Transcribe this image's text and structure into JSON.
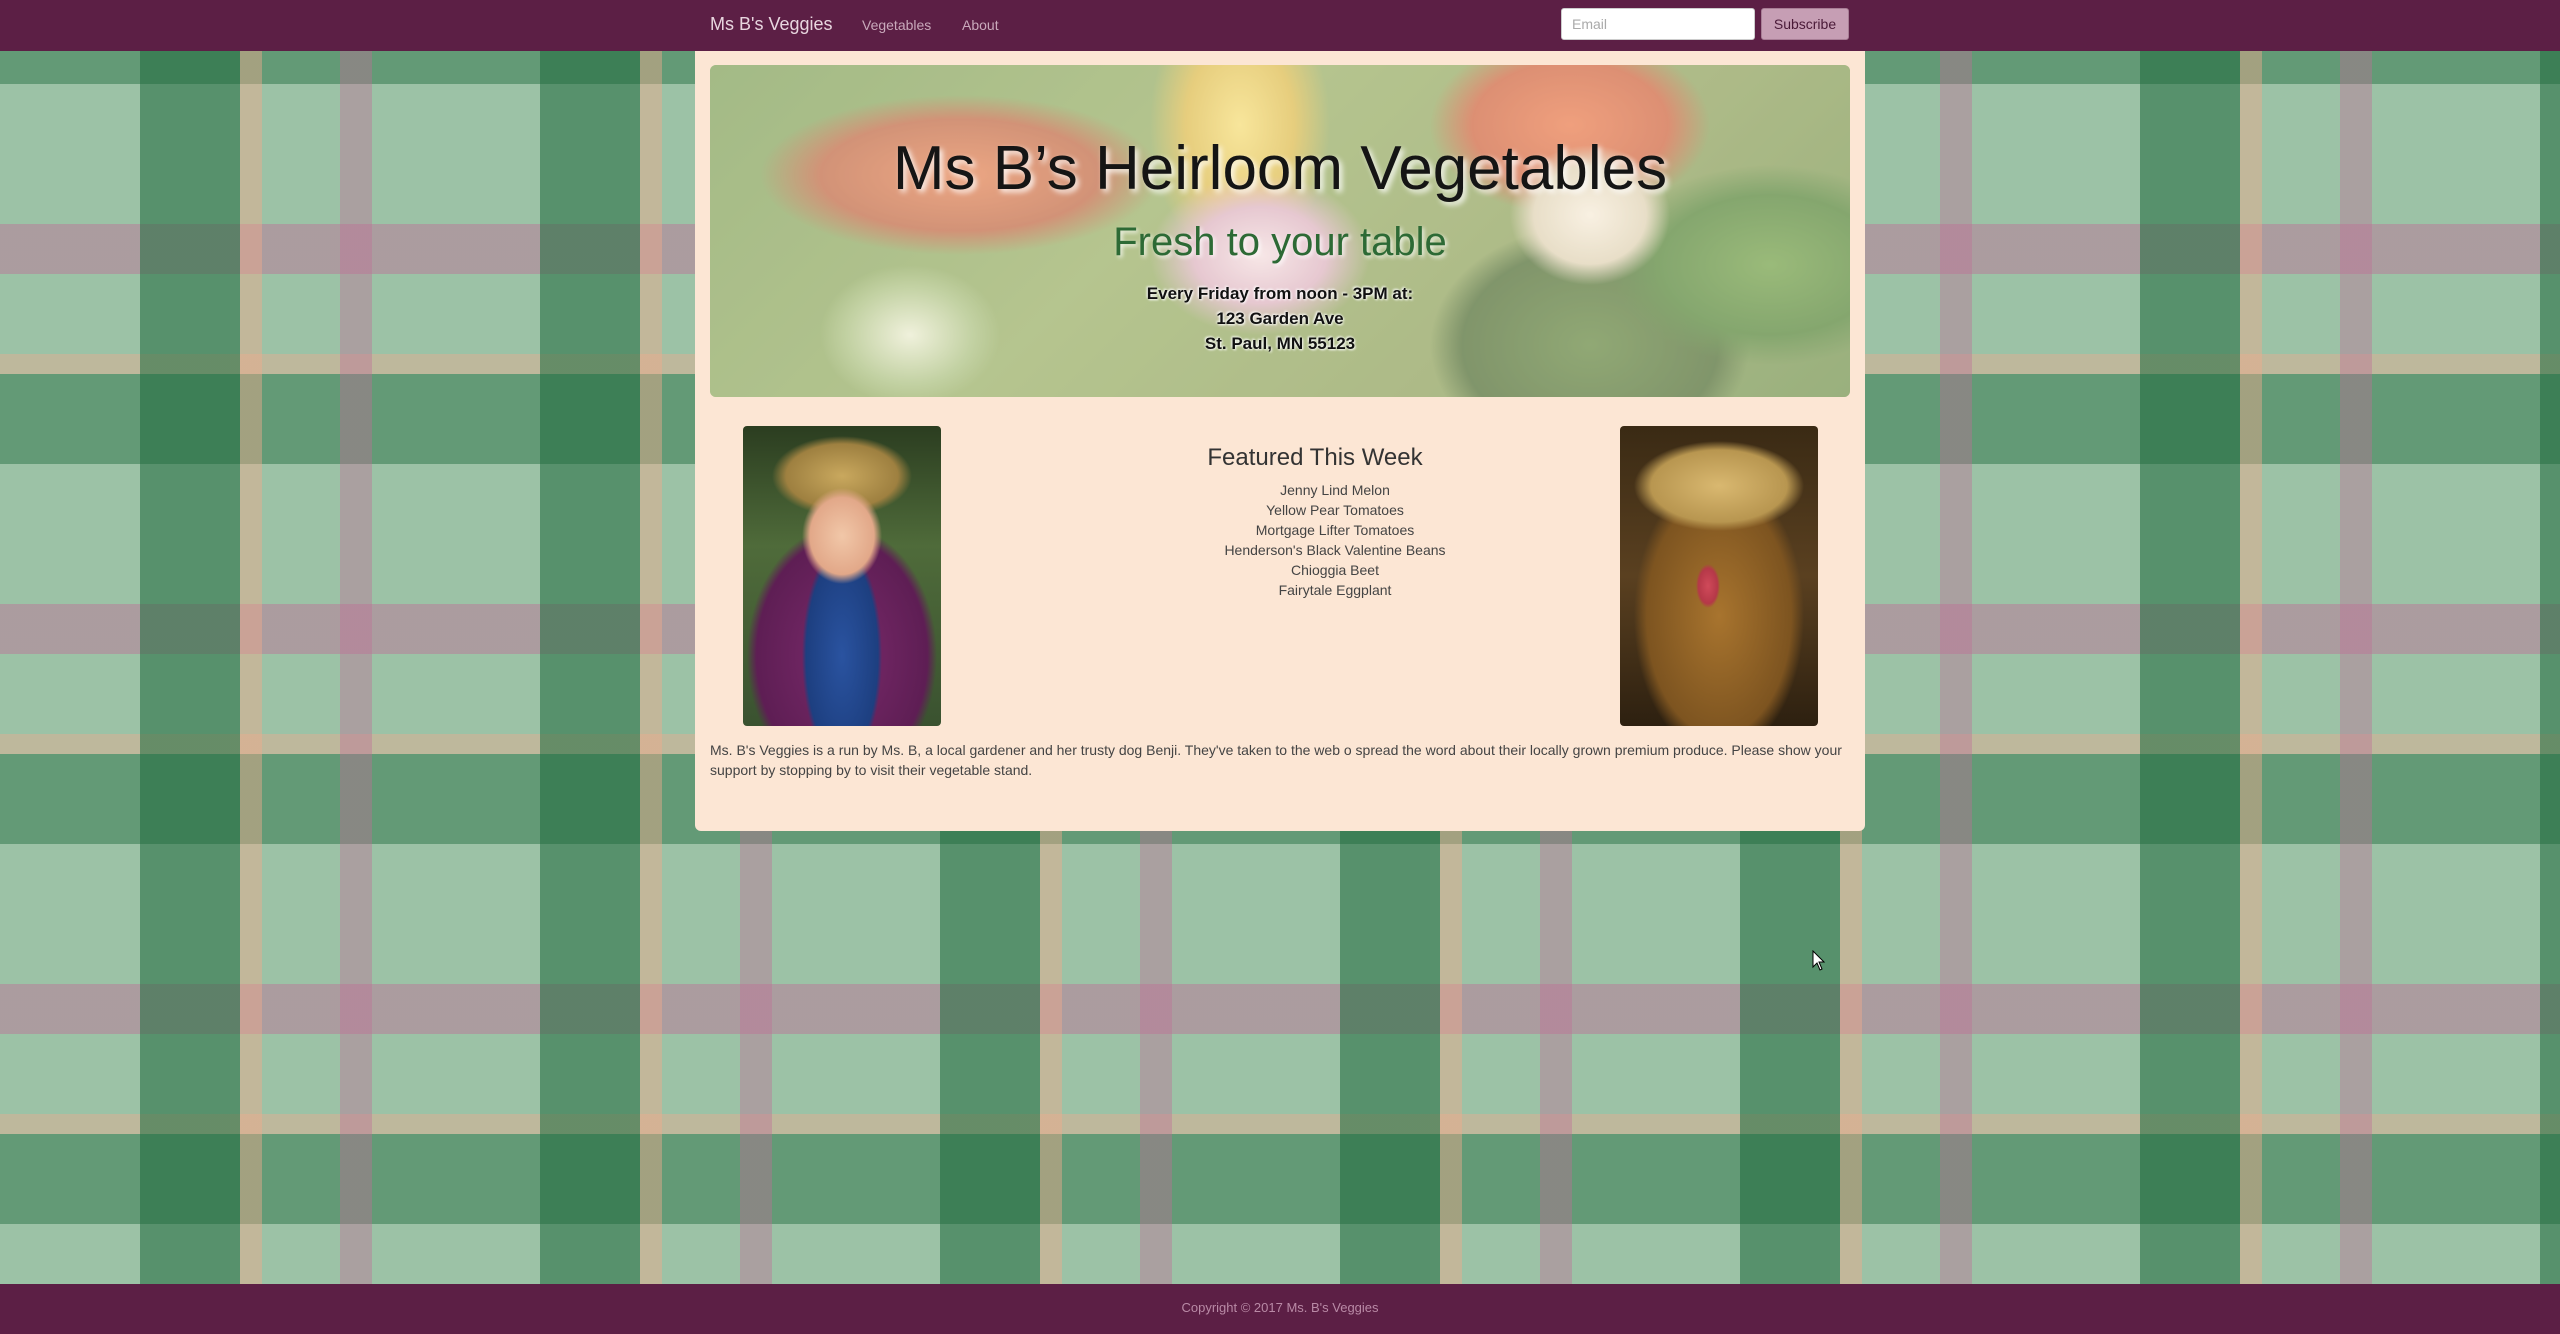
{
  "navbar": {
    "brand": "Ms B's Veggies",
    "links": [
      "Vegetables",
      "About"
    ],
    "email_placeholder": "Email",
    "subscribe_label": "Subscribe"
  },
  "jumbotron": {
    "title": "Ms B’s Heirloom Vegetables",
    "tagline": "Fresh to your table",
    "schedule": "Every Friday from noon - 3PM at:",
    "address_line1": "123 Garden Ave",
    "address_line2": "St. Paul, MN 55123"
  },
  "featured": {
    "heading": "Featured This Week",
    "items": [
      "Jenny Lind Melon",
      "Yellow Pear Tomatoes",
      "Mortgage Lifter Tomatoes",
      "Henderson's Black Valentine Beans",
      "Chioggia Beet",
      "Fairytale Eggplant"
    ]
  },
  "about": {
    "text": "Ms. B's Veggies is a run by Ms. B, a local gardener and her trusty dog Benji. They've taken to the web o spread the word about their locally grown premium produce. Please show your support by stopping by to visit their vegetable stand."
  },
  "footer": {
    "copyright": "Copyright © 2017 Ms. B's Veggies"
  },
  "colors": {
    "nav_bg": "#5c1f45",
    "container_bg": "#fce6d4",
    "tagline": "#2d6a35",
    "subscribe_bg": "#c69eb4"
  }
}
